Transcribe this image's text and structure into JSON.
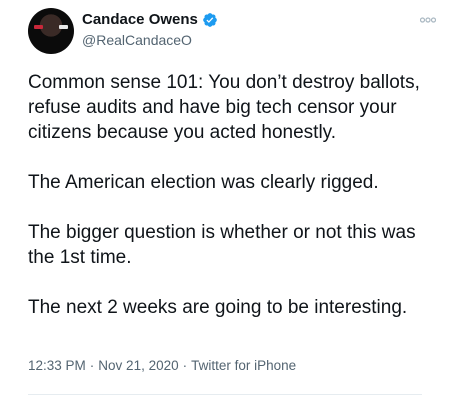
{
  "author": {
    "display_name": "Candace Owens",
    "handle": "@RealCandaceO",
    "verified_icon": "verified-badge-icon",
    "avatar_icon": "avatar-photo"
  },
  "menu_icon": "more-options-icon",
  "tweet": {
    "paragraphs": [
      "Common sense 101: You don’t destroy ballots,\nrefuse audits and have big tech censor your\ncitizens because you acted honestly.",
      "The American election was clearly rigged.",
      "The bigger question is whether or not this was\nthe 1st time.",
      "The next 2 weeks are going to be interesting."
    ],
    "time": "12:33 PM",
    "date": "Nov 21, 2020",
    "source": "Twitter for iPhone",
    "separator": "·"
  },
  "colors": {
    "text": "#0f1419",
    "secondary": "#536471",
    "verified": "#1d9bf0"
  }
}
